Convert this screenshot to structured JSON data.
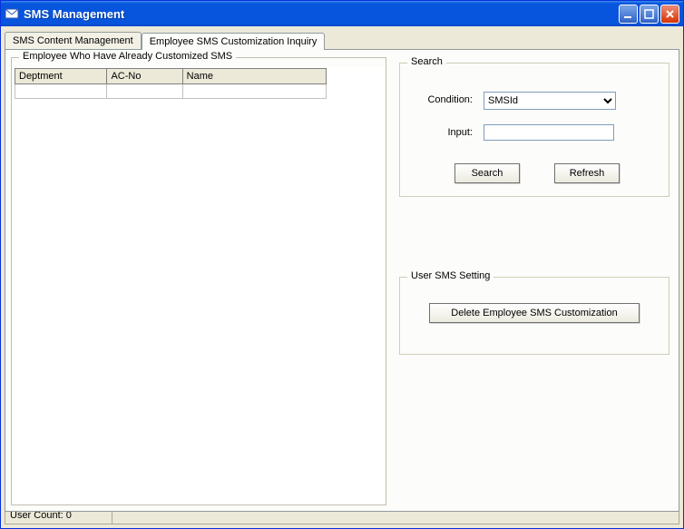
{
  "window": {
    "title": "SMS Management"
  },
  "tabs": {
    "content_mgmt": "SMS Content Management",
    "inquiry": "Employee SMS Customization Inquiry"
  },
  "employee_group": {
    "legend": "Employee Who Have Already Customized SMS",
    "columns": {
      "dept": "Deptment",
      "acno": "AC-No",
      "name": "Name"
    },
    "rows": []
  },
  "search": {
    "legend": "Search",
    "condition_label": "Condition:",
    "condition_value": "SMSId",
    "input_label": "Input:",
    "input_value": "",
    "search_btn": "Search",
    "refresh_btn": "Refresh"
  },
  "user_sms": {
    "legend": "User SMS Setting",
    "delete_btn": "Delete Employee SMS Customization"
  },
  "status": {
    "user_count_label": "User Count:",
    "user_count_value": "0"
  }
}
